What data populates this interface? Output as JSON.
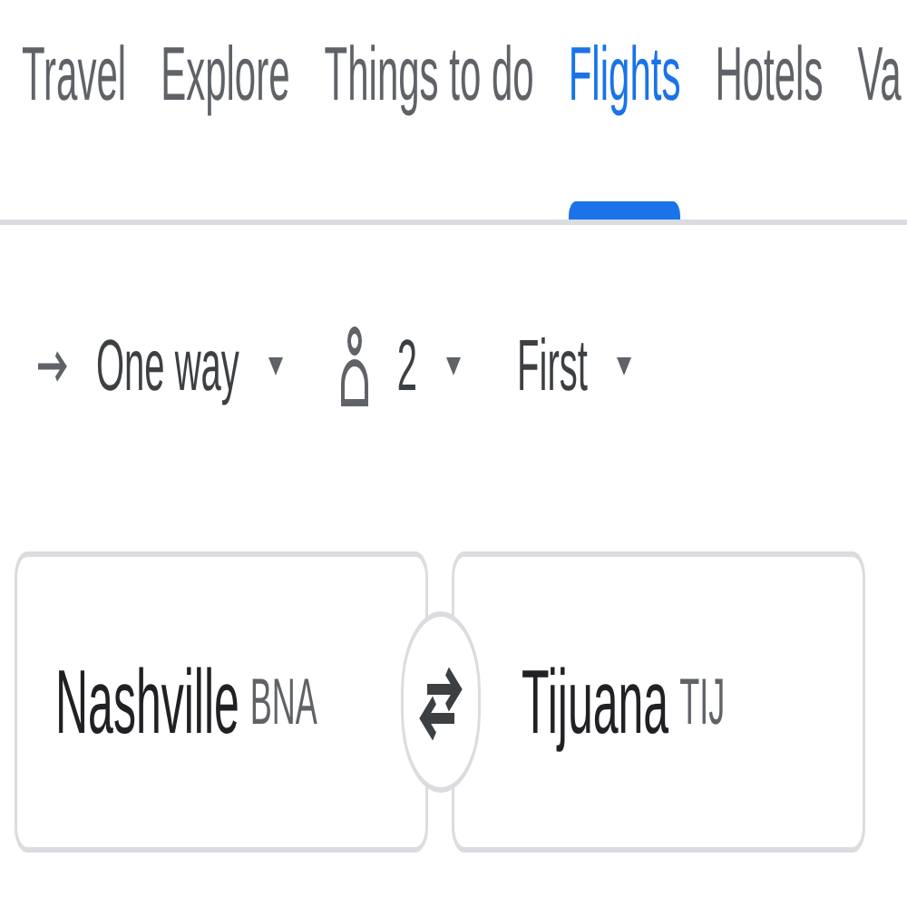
{
  "tabs": [
    {
      "label": "Travel",
      "selected": false
    },
    {
      "label": "Explore",
      "selected": false
    },
    {
      "label": "Things to do",
      "selected": false
    },
    {
      "label": "Flights",
      "selected": true
    },
    {
      "label": "Hotels",
      "selected": false
    },
    {
      "label": "Va",
      "selected": false
    }
  ],
  "options": [
    {
      "kind": "trip",
      "label": "One way"
    },
    {
      "kind": "passengers",
      "label": "2"
    },
    {
      "kind": "class",
      "label": "First"
    }
  ],
  "origin": {
    "city": "Nashville",
    "code": "BNA"
  },
  "destination": {
    "city": "Tijuana",
    "code": "TIJ"
  }
}
